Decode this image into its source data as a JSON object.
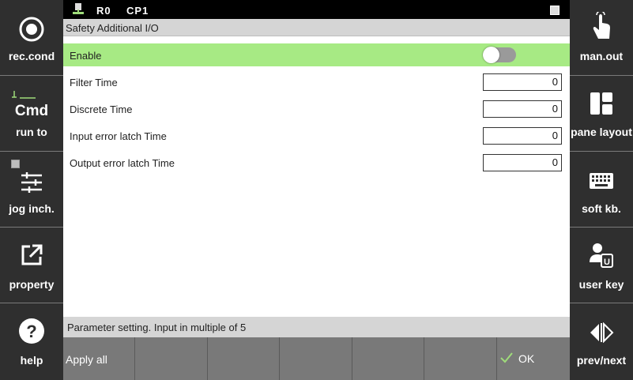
{
  "statusbar": {
    "robot": "R0",
    "cp": "CP1"
  },
  "title": "Safety Additional I/O",
  "enable": {
    "label": "Enable",
    "value": false
  },
  "params": [
    {
      "label": "Filter Time",
      "value": "0"
    },
    {
      "label": "Discrete Time",
      "value": "0"
    },
    {
      "label": "Input error latch Time",
      "value": "0"
    },
    {
      "label": "Output error latch Time",
      "value": "0"
    }
  ],
  "help": "Parameter setting. Input in multiple of 5",
  "left_buttons": {
    "rec_cond": "rec.cond",
    "run_to_cmd": "Cmd",
    "run_to": "run to",
    "jog_inch": "jog inch.",
    "property": "property",
    "help": "help"
  },
  "right_buttons": {
    "man_out": "man.out",
    "pane_layout": "pane layout",
    "soft_kb": "soft kb.",
    "user_key": "user key",
    "prev_next": "prev/next"
  },
  "bottom": {
    "apply_all": "Apply all",
    "ok": "OK"
  },
  "colors": {
    "enable_row": "#a7ea84",
    "panel": "#2f2f2f",
    "softkey": "#797979"
  }
}
